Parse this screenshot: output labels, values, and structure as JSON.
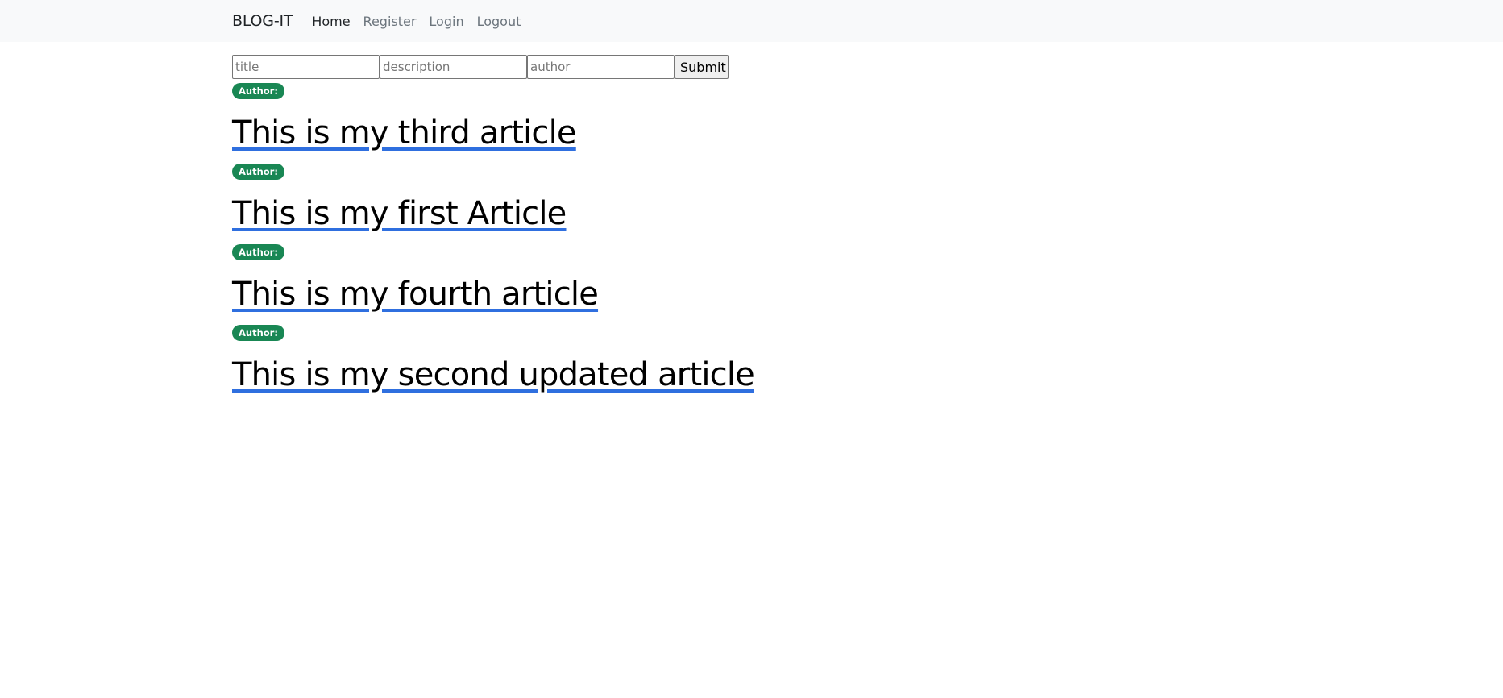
{
  "nav": {
    "brand": "BLOG-IT",
    "links": [
      {
        "label": "Home",
        "active": true
      },
      {
        "label": "Register",
        "active": false
      },
      {
        "label": "Login",
        "active": false
      },
      {
        "label": "Logout",
        "active": false
      }
    ]
  },
  "form": {
    "title_placeholder": "title",
    "title_value": "",
    "description_placeholder": "description",
    "description_value": "",
    "author_placeholder": "author",
    "author_value": "",
    "submit_label": "Submit"
  },
  "articles": [
    {
      "author_badge": "Author:",
      "title": "This is my third article"
    },
    {
      "author_badge": "Author:",
      "title": "This is my first Article"
    },
    {
      "author_badge": "Author:",
      "title": "This is my fourth article"
    },
    {
      "author_badge": "Author:",
      "title": "This is my second updated article"
    }
  ],
  "colors": {
    "navbar_bg": "#f8f9fa",
    "badge_bg": "#198754",
    "link_underline": "#2f6fdf"
  }
}
